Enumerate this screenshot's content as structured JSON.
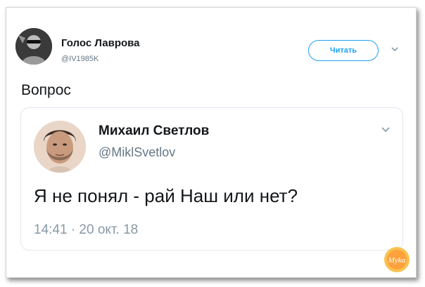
{
  "tweet": {
    "author_name": "Голос Лаврова",
    "author_handle": "@IV1985K",
    "follow_label": "Читать",
    "text": "Вопрос"
  },
  "quoted": {
    "author_name": "Михаил Светлов",
    "author_handle": "@MiklSvetlov",
    "text": "Я не понял - рай Наш или нет?",
    "timestamp": "14:41 · 20 окт. 18"
  },
  "watermark": {
    "text": "Myka"
  },
  "colors": {
    "accent": "#1da1f2",
    "secondary_text": "#657786",
    "border": "#e1e8ed"
  },
  "icons": [
    "avatar-image",
    "chevron-down-icon",
    "watermark-logo"
  ]
}
